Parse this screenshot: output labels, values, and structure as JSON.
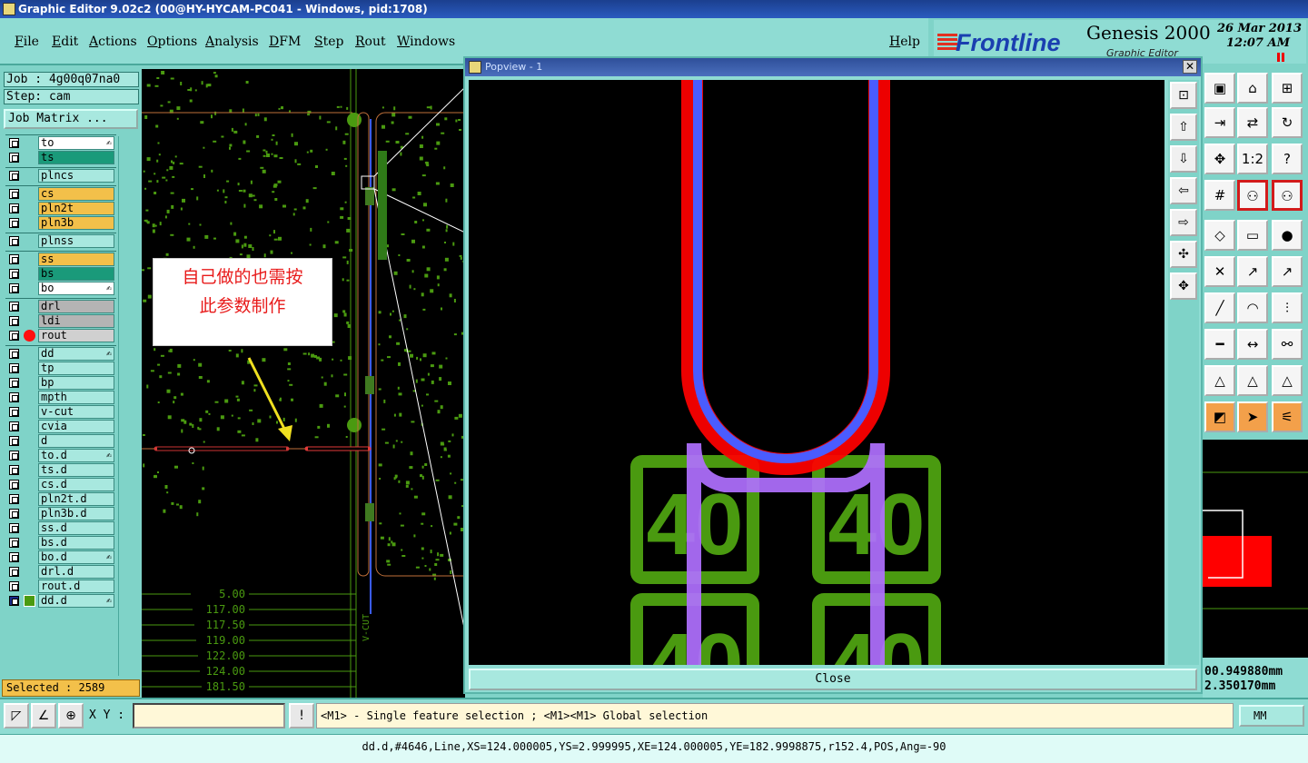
{
  "window": {
    "title": "Graphic Editor 9.02c2 (00@HY-HYCAM-PC041 - Windows, pid:1708)"
  },
  "menu": [
    "File",
    "Edit",
    "Actions",
    "Options",
    "Analysis",
    "DFM",
    "Step",
    "Rout",
    "Windows"
  ],
  "help_label": "Help",
  "brand": {
    "logo": "Frontline",
    "product": "Genesis 2000",
    "subtitle": "Graphic Editor",
    "date": "26 Mar 2013",
    "time": "12:07 AM"
  },
  "job": {
    "job_label": "Job : 4g00q07na0",
    "step_label": "Step: cam",
    "matrix_button": "Job Matrix ..."
  },
  "layers": [
    {
      "name": "to",
      "color": "#ffffff",
      "hand": true
    },
    {
      "name": "ts",
      "color": "#1a9a7a",
      "hand": false
    },
    {
      "name": "plncs",
      "color": "#a8e8df",
      "hand": false
    },
    {
      "name": "cs",
      "color": "#f3c04a",
      "hand": false
    },
    {
      "name": "pln2t",
      "color": "#f3c04a",
      "hand": false
    },
    {
      "name": "pln3b",
      "color": "#f3c04a",
      "hand": false
    },
    {
      "name": "plnss",
      "color": "#a8e8df",
      "hand": false
    },
    {
      "name": "ss",
      "color": "#f3c04a",
      "hand": false
    },
    {
      "name": "bs",
      "color": "#1a9a7a",
      "hand": false
    },
    {
      "name": "bo",
      "color": "#ffffff",
      "hand": true
    },
    {
      "name": "drl",
      "color": "#b4b4b4",
      "hand": false
    },
    {
      "name": "ldi",
      "color": "#b4b4b4",
      "hand": false
    },
    {
      "name": "rout",
      "color": "#d0d0d0",
      "hand": false,
      "active": true
    },
    {
      "name": "dd",
      "color": "#a8e8df",
      "hand": true
    },
    {
      "name": "tp",
      "color": "#a8e8df",
      "hand": false
    },
    {
      "name": "bp",
      "color": "#a8e8df",
      "hand": false
    },
    {
      "name": "mpth",
      "color": "#a8e8df",
      "hand": false
    },
    {
      "name": "v-cut",
      "color": "#a8e8df",
      "hand": false
    },
    {
      "name": "cvia",
      "color": "#a8e8df",
      "hand": false
    },
    {
      "name": "d",
      "color": "#a8e8df",
      "hand": false
    },
    {
      "name": "to.d",
      "color": "#a8e8df",
      "hand": true
    },
    {
      "name": "ts.d",
      "color": "#a8e8df",
      "hand": false
    },
    {
      "name": "cs.d",
      "color": "#a8e8df",
      "hand": false
    },
    {
      "name": "pln2t.d",
      "color": "#a8e8df",
      "hand": false
    },
    {
      "name": "pln3b.d",
      "color": "#a8e8df",
      "hand": false
    },
    {
      "name": "ss.d",
      "color": "#a8e8df",
      "hand": false
    },
    {
      "name": "bs.d",
      "color": "#a8e8df",
      "hand": false
    },
    {
      "name": "bo.d",
      "color": "#a8e8df",
      "hand": true
    },
    {
      "name": "drl.d",
      "color": "#a8e8df",
      "hand": false
    },
    {
      "name": "rout.d",
      "color": "#a8e8df",
      "hand": false
    },
    {
      "name": "dd.d",
      "color": "#a8e8df",
      "hand": true,
      "work": true
    }
  ],
  "selected_label": "Selected : 2589",
  "annotation": {
    "line1": "自己做的也需按",
    "line2": "此参数制作"
  },
  "dimensions": [
    "5.00",
    "117.00",
    "117.50",
    "119.00",
    "122.00",
    "124.00",
    "181.50"
  ],
  "vcut_label": "V-CUT",
  "popview": {
    "title": "Popview - 1",
    "close_label": "Close",
    "pad_label": "40"
  },
  "coords": {
    "x": "00.949880mm",
    "y": "2.350170mm"
  },
  "bottom": {
    "xy_label": "X Y :",
    "message": "<M1> - Single feature selection ; <M1><M1> Global selection",
    "units": "MM"
  },
  "status": "dd.d,#4646,Line,XS=124.000005,YS=2.999995,XE=124.000005,YE=182.9998875,r152.4,POS,Ang=-90",
  "colors": {
    "accent": "#7fd3c8",
    "route_red": "#ff0000",
    "route_blue": "#4a5cff",
    "route_purple": "#b070ff",
    "pad_green": "#4a9a10"
  }
}
